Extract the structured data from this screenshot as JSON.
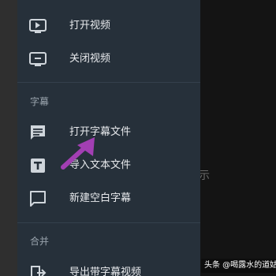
{
  "menu": {
    "video_items": [
      {
        "label": "打开视频",
        "icon": "play-video-icon"
      },
      {
        "label": "关闭视频",
        "icon": "close-video-icon"
      }
    ],
    "subtitle_section": {
      "header": "字幕",
      "items": [
        {
          "label": "打开字幕文件",
          "icon": "subtitle-file-icon"
        },
        {
          "label": "导入文本文件",
          "icon": "import-text-icon"
        },
        {
          "label": "新建空白字幕",
          "icon": "new-subtitle-icon"
        }
      ]
    },
    "merge_section": {
      "header": "合并",
      "items": [
        {
          "label": "导出带字幕视频",
          "icon": "export-video-icon"
        }
      ]
    }
  },
  "background": {
    "hint_text": "示"
  },
  "watermark": {
    "text": "头条 @喝露水的道姑"
  },
  "colors": {
    "drawer": "#26303a",
    "icon": "#cfd5db",
    "annotation_arrow": "#a23fb3"
  }
}
